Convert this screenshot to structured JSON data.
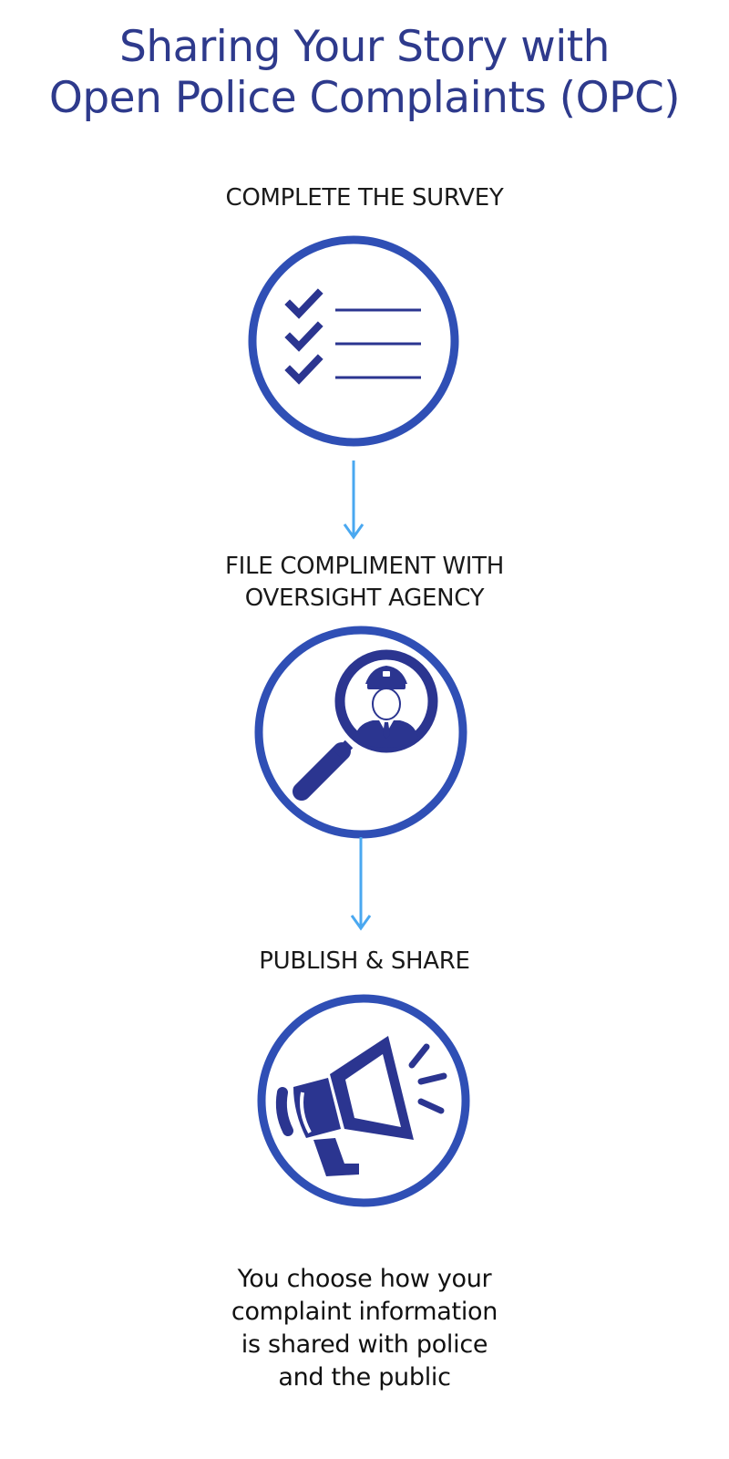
{
  "title": {
    "line1": "Sharing Your Story with",
    "line2": "Open Police Complaints (OPC)"
  },
  "steps": [
    {
      "label_lines": [
        "COMPLETE THE SURVEY"
      ],
      "icon": "checklist-icon"
    },
    {
      "label_lines": [
        "FILE COMPLIMENT WITH",
        "OVERSIGHT AGENCY"
      ],
      "icon": "officer-search-icon"
    },
    {
      "label_lines": [
        "PUBLISH & SHARE"
      ],
      "icon": "megaphone-icon"
    }
  ],
  "footer": {
    "lines": [
      "You choose how your",
      "complaint information",
      "is shared with police",
      "and the public"
    ]
  },
  "colors": {
    "title": "#2e3a8c",
    "circle_border": "#2f4fb5",
    "icon_fill": "#2b3590",
    "arrow": "#4aa8f0",
    "text": "#1a1a1a"
  }
}
